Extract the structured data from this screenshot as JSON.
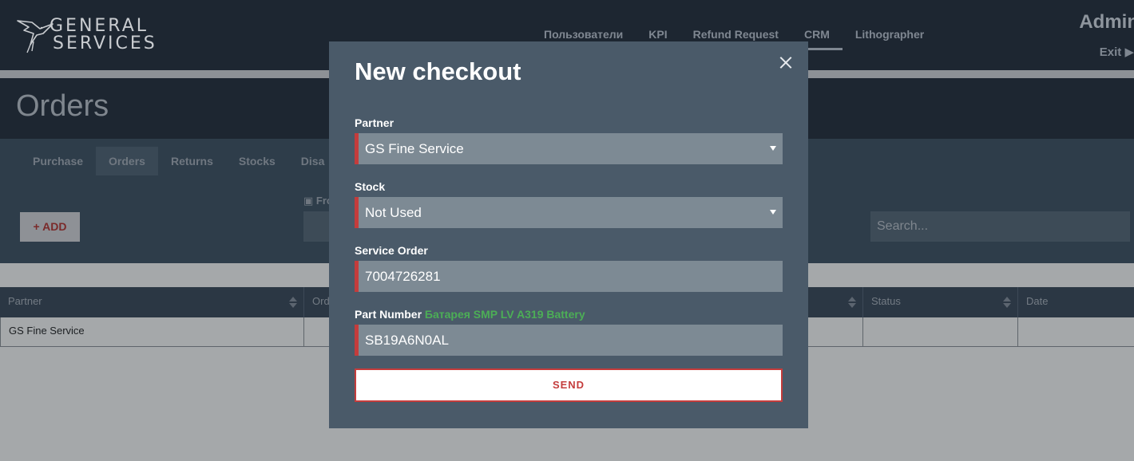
{
  "header": {
    "logo": {
      "line1": "GENERAL",
      "line2": "SERVICES",
      "icon": "hummingbird-logo-icon"
    },
    "nav": [
      {
        "label": "Пользователи",
        "active": false
      },
      {
        "label": "KPI",
        "active": false
      },
      {
        "label": "Refund Request",
        "active": false
      },
      {
        "label": "CRM",
        "active": true
      },
      {
        "label": "Lithographer",
        "active": false
      }
    ],
    "user": "Admin",
    "exit_label": "Exit ▶"
  },
  "page": {
    "title": "Orders",
    "tabs": [
      {
        "label": "Purchase",
        "active": false
      },
      {
        "label": "Orders",
        "active": true
      },
      {
        "label": "Returns",
        "active": false
      },
      {
        "label": "Stocks",
        "active": false
      },
      {
        "label": "Disa",
        "active": false
      }
    ],
    "add_label": "+ ADD",
    "from_label": "▣ Fro",
    "search_placeholder": "Search..."
  },
  "table": {
    "columns": [
      "Partner",
      "Ord",
      "Status",
      "Date"
    ],
    "rows": [
      [
        "GS Fine Service",
        "",
        "",
        ""
      ]
    ]
  },
  "modal": {
    "title": "New checkout",
    "close_icon": "close-icon",
    "partner": {
      "label": "Partner",
      "value": "GS Fine Service"
    },
    "stock": {
      "label": "Stock",
      "value": "Not Used"
    },
    "service_order": {
      "label": "Service Order",
      "value": "7004726281"
    },
    "part_number": {
      "label": "Part Number",
      "hint": "Батарея SMP LV A319 Battery",
      "value": "SB19A6N0AL"
    },
    "send_label": "SEND"
  },
  "colors": {
    "accent_red": "#c43c3c",
    "hint_green": "#4cae56",
    "modal_bg": "#4a5a69",
    "header_bg": "#1d2631"
  }
}
